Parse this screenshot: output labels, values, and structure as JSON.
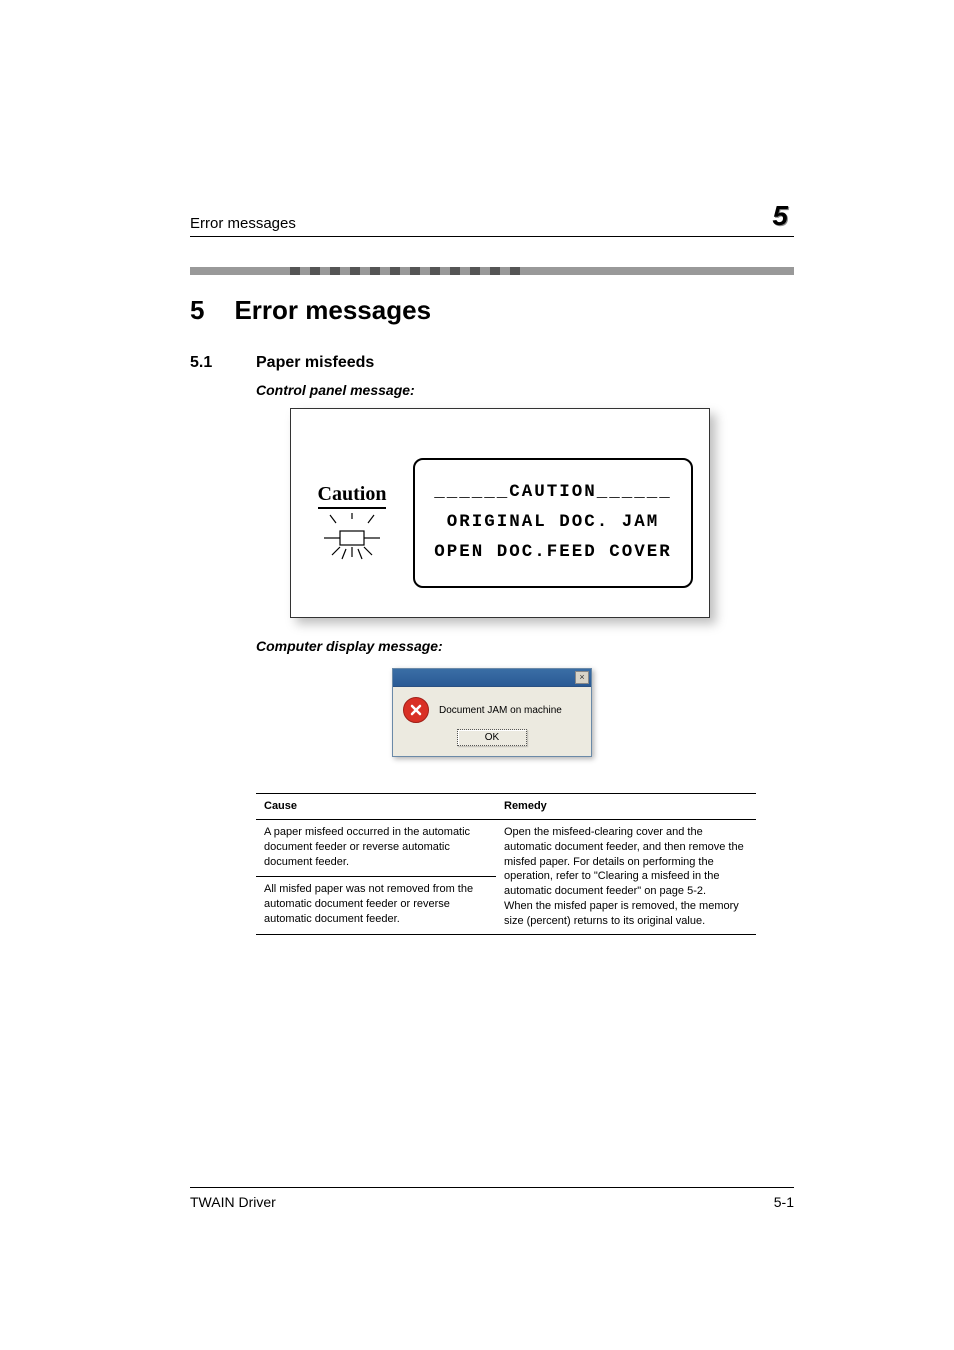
{
  "header": {
    "running_text": "Error messages",
    "chapter_number": "5"
  },
  "headings": {
    "h1_number": "5",
    "h1_title": "Error messages",
    "h2_number": "5.1",
    "h2_title": "Paper misfeeds",
    "sub1": "Control panel message:",
    "sub2": "Computer display message:"
  },
  "lcd": {
    "caution_label": "Caution",
    "caution_icon": "sun-rays-icon",
    "line1": "______CAUTION______",
    "line2": "ORIGINAL DOC. JAM",
    "line3": "OPEN DOC.FEED COVER"
  },
  "dialog": {
    "close_label": "×",
    "error_icon": "error-circle-icon",
    "message": "Document JAM on machine",
    "ok_label": "OK"
  },
  "table": {
    "col1_header": "Cause",
    "col2_header": "Remedy",
    "cause1": "A paper misfeed occurred in the automatic document feeder or reverse automatic document feeder.",
    "cause2": "All misfed paper was not removed from the automatic document feeder or reverse automatic document feeder.",
    "remedy": "Open the misfeed-clearing cover and the automatic document feeder, and then remove the misfed paper. For details on performing the operation, refer to \"Clearing a misfeed in the automatic document feeder\" on page 5-2.\nWhen the misfed paper is removed, the memory size (percent) returns to its original value."
  },
  "footer": {
    "left": "TWAIN Driver",
    "right": "5-1"
  }
}
